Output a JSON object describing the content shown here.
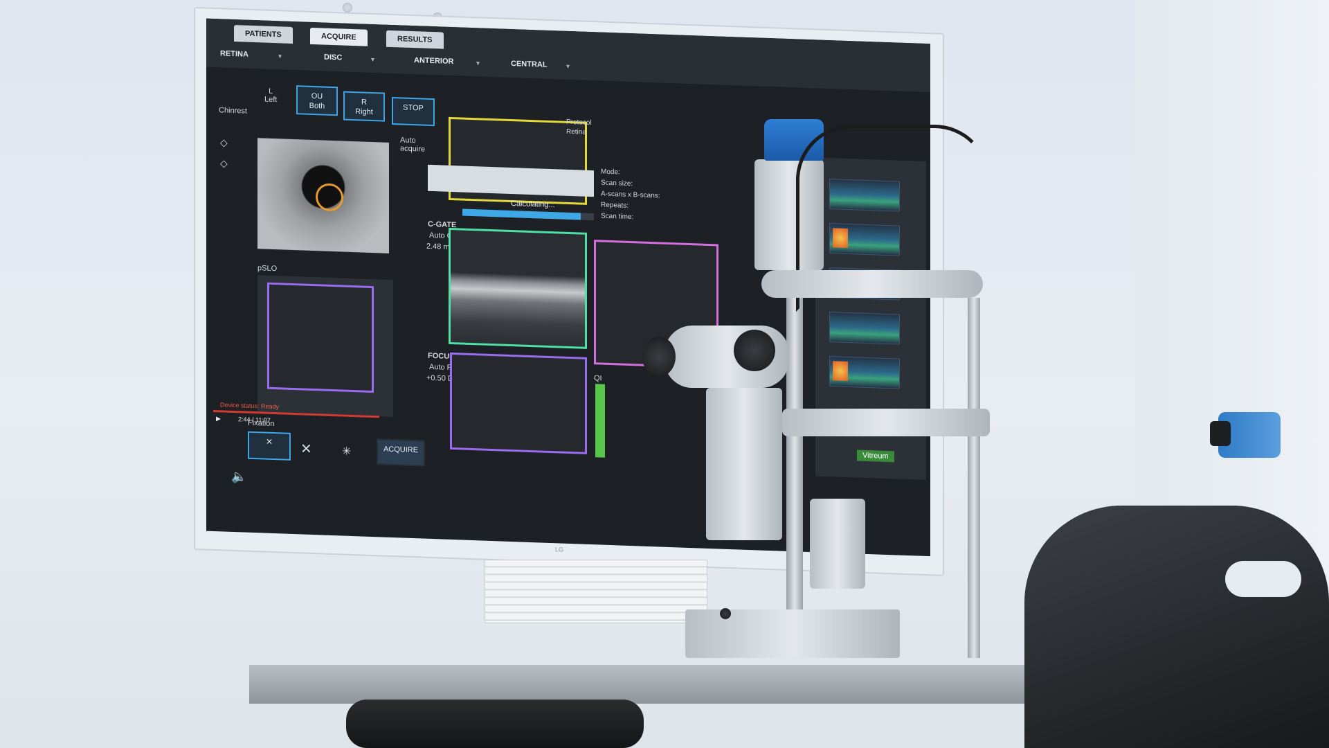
{
  "screen": {
    "tabs": [
      "PATIENTS",
      "ACQUIRE",
      "RESULTS"
    ],
    "modes": [
      "RETINA",
      "DISC",
      "ANTERIOR",
      "CENTRAL"
    ],
    "eye_buttons": {
      "left": "L\nLeft",
      "both": "OU\nBoth",
      "right": "R\nRight",
      "stop": "STOP"
    },
    "chinrest_label": "Chinrest",
    "auto_acquire": "Auto\nacquire",
    "pslo_label": "pSLO",
    "fixation_label": "Fixation",
    "acquire_button": "ACQUIRE",
    "cgate": {
      "label": "C-GATE",
      "mode": "Auto C",
      "value": "2.48 mm"
    },
    "focus": {
      "label": "FOCUS",
      "mode": "Auto F",
      "value": "+0.50 D"
    },
    "calculating": "Calculating...",
    "progress": 0.9,
    "protocol": {
      "label": "Protocol",
      "value": "Retina"
    },
    "scan_info_labels": [
      "Mode:",
      "Scan size:",
      "A-scans x B-scans:",
      "Repeats:",
      "Scan time:"
    ],
    "qi_label": "QI",
    "device_status": "Device status: Ready",
    "video_time": "2:44 / 11:07",
    "brand_logo": "Vitreum",
    "monitor_brand": "LG"
  },
  "colors": {
    "accent": "#3fa5e8",
    "frame_yellow": "#e4d83a",
    "frame_green": "#4fe0a6",
    "frame_purple": "#9a6cf0",
    "frame_pink": "#d46fe0",
    "blue_cap": "#2e7fd6"
  }
}
